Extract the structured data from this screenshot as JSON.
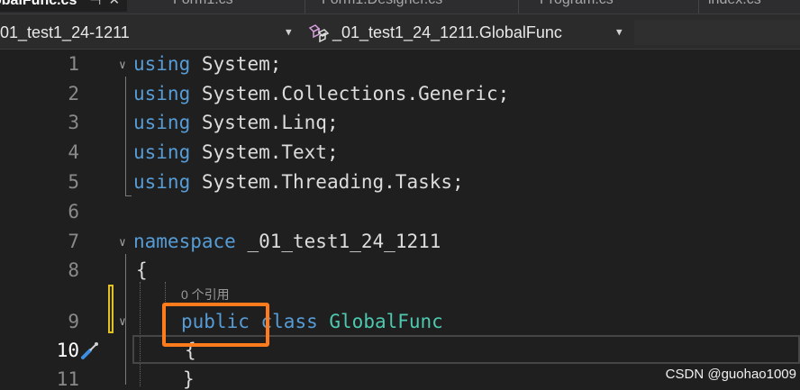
{
  "tabs": [
    {
      "label": "obalFunc.cs",
      "active": true
    },
    {
      "label": "Form1.cs",
      "active": false
    },
    {
      "label": "Form1.Designer.cs",
      "active": false
    },
    {
      "label": "Program.cs",
      "active": false
    },
    {
      "label": "index.cs",
      "active": false
    }
  ],
  "tab_icons": {
    "pin": "pin-icon",
    "close": "close-icon"
  },
  "nav": {
    "project_combo": "01_test1_24-1211",
    "member_combo": "_01_test1_24_1211.GlobalFunc"
  },
  "lines": [
    {
      "num": "1",
      "tokens": [
        [
          "kw",
          "using"
        ],
        [
          "",
          "System;"
        ]
      ]
    },
    {
      "num": "2",
      "tokens": [
        [
          "kw",
          "using"
        ],
        [
          "",
          "System.Collections.Generic;"
        ]
      ]
    },
    {
      "num": "3",
      "tokens": [
        [
          "kw",
          "using"
        ],
        [
          "",
          "System.Linq;"
        ]
      ]
    },
    {
      "num": "4",
      "tokens": [
        [
          "kw",
          "using"
        ],
        [
          "",
          "System.Text;"
        ]
      ]
    },
    {
      "num": "5",
      "tokens": [
        [
          "kw",
          "using"
        ],
        [
          "",
          "System.Threading.Tasks;"
        ]
      ]
    },
    {
      "num": "6",
      "tokens": []
    },
    {
      "num": "7",
      "tokens": [
        [
          "kw",
          "namespace"
        ],
        [
          "",
          "_01_test1_24_1211"
        ]
      ]
    },
    {
      "num": "8",
      "tokens": [
        [
          "",
          "{"
        ]
      ]
    },
    {
      "num": "9",
      "tokens": [
        [
          "kw",
          "public"
        ],
        [
          "kw",
          "class"
        ],
        [
          "ty",
          "GlobalFunc"
        ]
      ]
    },
    {
      "num": "10",
      "tokens": [
        [
          "",
          "{"
        ]
      ]
    },
    {
      "num": "11",
      "tokens": [
        [
          "",
          "}"
        ]
      ]
    }
  ],
  "codelens": "0 个引用",
  "watermark": "CSDN @guohao1009",
  "colors": {
    "keyword": "#569cd6",
    "type": "#4ec9b0",
    "highlight_box": "#ff7b1c"
  }
}
